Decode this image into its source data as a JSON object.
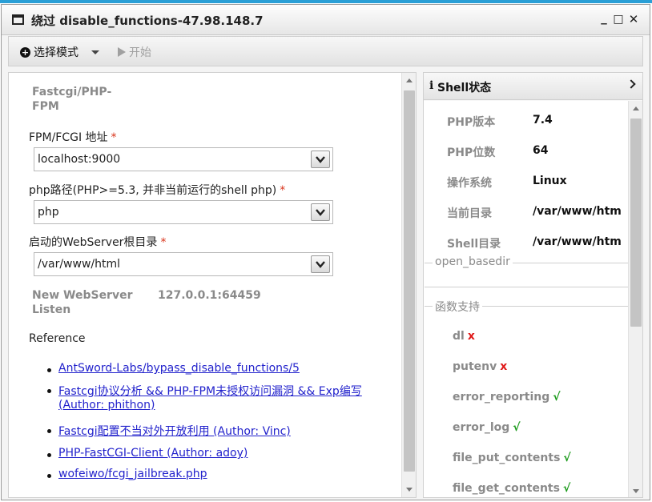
{
  "window": {
    "title": "绕过 disable_functions-47.98.148.7",
    "buttons": {
      "minimize": "_",
      "maximize": "□",
      "close": "✕"
    }
  },
  "toolbar": {
    "mode_label": "选择模式",
    "start_label": "开始"
  },
  "form": {
    "section_title": "Fastcgi/PHP-FPM",
    "fields": [
      {
        "label": "FPM/FCGI 地址",
        "value": "localhost:9000"
      },
      {
        "label": "php路径(PHP>=5.3, 并非当前运行的shell php)",
        "value": "php"
      },
      {
        "label": "启动的WebServer根目录",
        "value": "/var/www/html"
      }
    ],
    "required_mark": "*",
    "new_server_label": "New WebServer Listen",
    "new_server_value": "127.0.0.1:64459",
    "reference_label": "Reference",
    "references": [
      "AntSword-Labs/bypass_disable_functions/5",
      "Fastcgi协议分析 && PHP-FPM未授权访问漏洞 && Exp编写 (Author: phithon)",
      "Fastcgi配置不当对外开放利用 (Author: Vinc)",
      "PHP-FastCGI-Client (Author: adoy)",
      "wofeiwo/fcgi_jailbreak.php"
    ]
  },
  "shell_status": {
    "title": "Shell状态",
    "info": [
      {
        "key": "PHP版本",
        "value": "7.4"
      },
      {
        "key": "PHP位数",
        "value": "64"
      },
      {
        "key": "操作系统",
        "value": "Linux"
      },
      {
        "key": "当前目录",
        "value": "/var/www/htm"
      },
      {
        "key": "Shell目录",
        "value": "/var/www/htm"
      }
    ],
    "open_basedir_label": "open_basedir",
    "functions_label": "函数支持",
    "functions": [
      {
        "name": "dl",
        "mark": "x"
      },
      {
        "name": "putenv",
        "mark": "x"
      },
      {
        "name": "error_reporting",
        "mark": "√"
      },
      {
        "name": "error_log",
        "mark": "√"
      },
      {
        "name": "file_put_contents",
        "mark": "√"
      },
      {
        "name": "file_get_contents",
        "mark": "√"
      }
    ]
  }
}
